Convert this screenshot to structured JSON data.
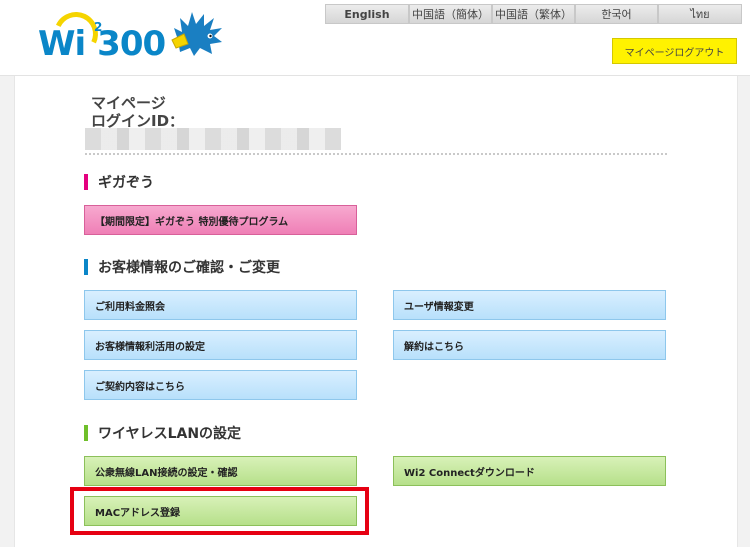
{
  "header": {
    "logo_text": "Wi",
    "logo_sup": "2",
    "logo_num": "300",
    "languages": [
      "English",
      "中国語（簡体）",
      "中国語（繁体）",
      "한국어",
      "ไทย"
    ],
    "logout_label": "マイページログアウト"
  },
  "account": {
    "title": "マイページ",
    "login_id_label": "ログインID："
  },
  "sections": {
    "giga": {
      "title": "ギガぞう",
      "bar_color": "#e4007f",
      "buttons": [
        "【期間限定】ギガぞう 特別優待プログラム"
      ]
    },
    "customer": {
      "title": "お客様情報のご確認・ご変更",
      "bar_color": "#0a86c8",
      "buttons": [
        "ご利用料金照会",
        "ユーザ情報変更",
        "お客様情報利活用の設定",
        "解約はこちら",
        "ご契約内容はこちら"
      ]
    },
    "wlan": {
      "title": "ワイヤレスLANの設定",
      "bar_color": "#6fbf2a",
      "buttons": [
        "公衆無線LAN接続の設定・確認",
        "Wi2 Connectダウンロード",
        "MACアドレス登録"
      ]
    }
  },
  "highlight_color": "#e60012"
}
